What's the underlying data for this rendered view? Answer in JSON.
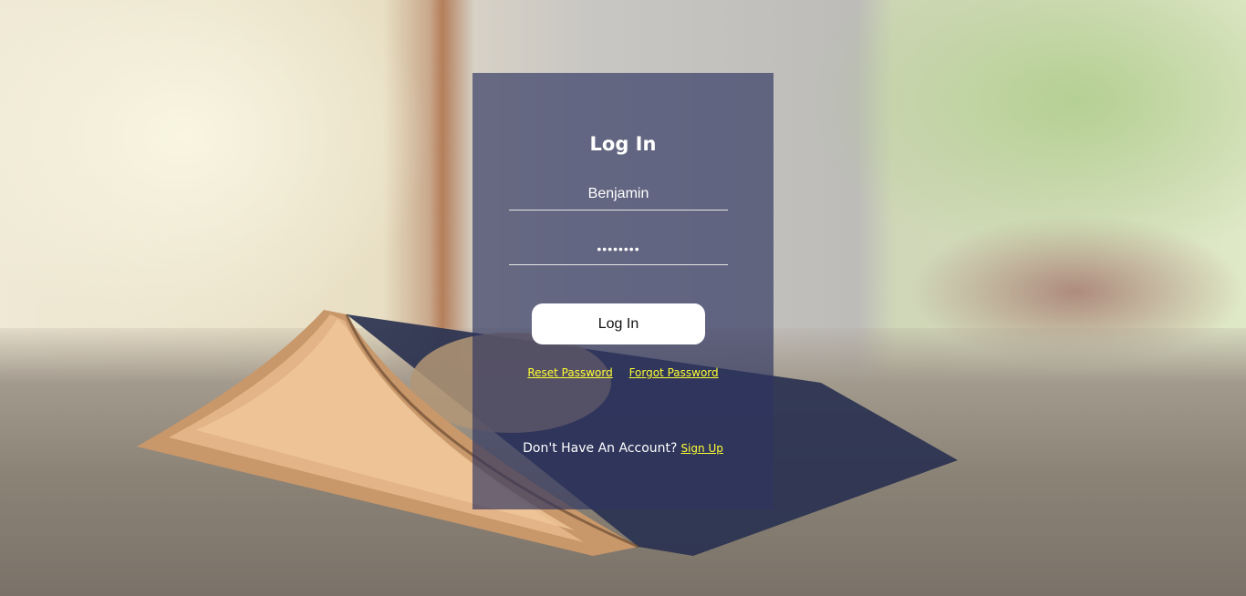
{
  "login": {
    "title": "Log In",
    "username_value": "Benjamin",
    "password_value": "••••••••",
    "submit_label": "Log In",
    "reset_password_label": "Reset Password",
    "forgot_password_label": "Forgot Password",
    "no_account_text": "Don't Have An Account?",
    "signup_label": "Sign Up"
  },
  "colors": {
    "card_background": "#2d3460",
    "link": "#ffff33",
    "button": "#ffffff"
  }
}
